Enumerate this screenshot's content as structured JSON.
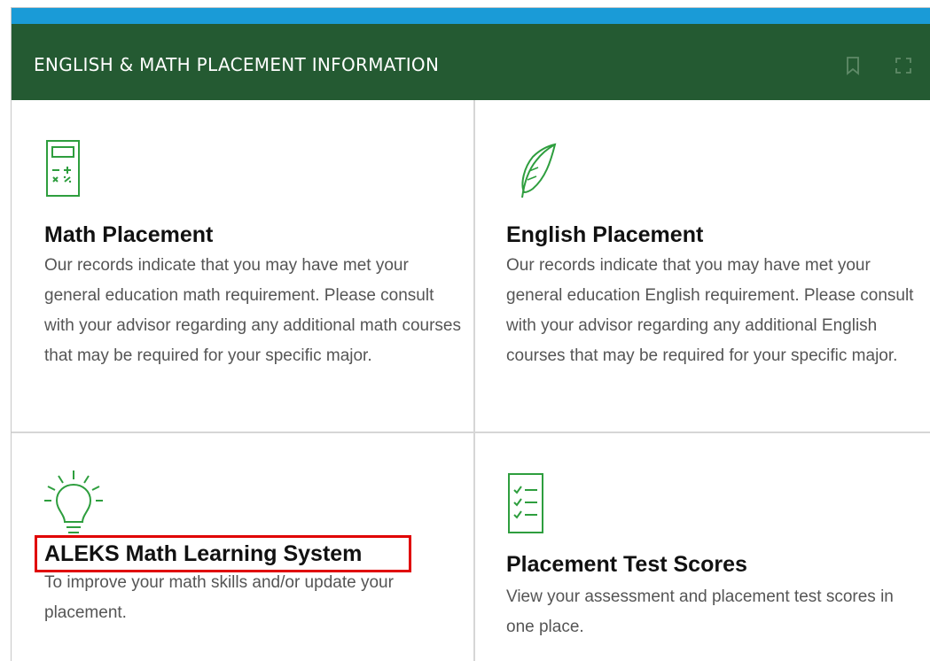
{
  "header": {
    "title": "ENGLISH & MATH PLACEMENT INFORMATION"
  },
  "tiles": [
    {
      "title": "Math Placement",
      "text": "Our records indicate that you may have met your general education math requirement. Please consult with your advisor regarding any additional math courses that may be required for your specific major."
    },
    {
      "title": "English Placement",
      "text": "Our records indicate that you may have met your general education English requirement. Please consult with your advisor regarding any additional English courses that may be required for your specific major."
    },
    {
      "title": "ALEKS Math Learning System",
      "text": "To improve your math skills and/or update your placement."
    },
    {
      "title": "Placement Test Scores",
      "text": "View your assessment and placement test scores in one place."
    }
  ],
  "colors": {
    "header_bg": "#245a32",
    "top_bar": "#1a9bd7",
    "icon_green": "#2e9e3e",
    "highlight": "#e00000"
  },
  "icons": [
    "calculator-icon",
    "feather-icon",
    "lightbulb-icon",
    "checklist-icon",
    "bookmark-icon",
    "expand-icon"
  ]
}
